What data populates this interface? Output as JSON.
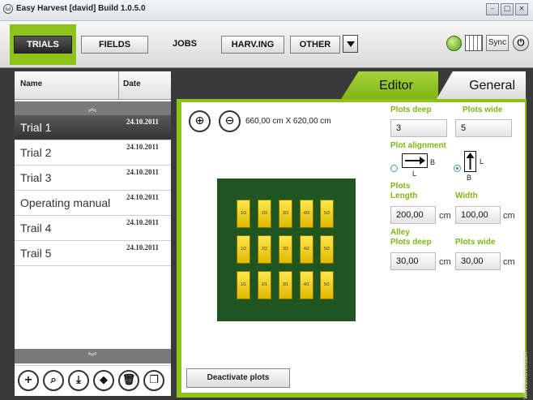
{
  "window": {
    "title": "Easy Harvest [david] Build 1.0.5.0",
    "icon": "app-icon",
    "minimize": "–",
    "maximize": "□",
    "close": "×"
  },
  "toolbar": {
    "tabs": [
      "TRIALS",
      "FIELDS",
      "JOBS",
      "HARV.ING",
      "OTHER"
    ],
    "active": "TRIALS",
    "sync_label": "Sync",
    "power_icon": "power-icon"
  },
  "trials": {
    "columns": {
      "name": "Name",
      "date": "Date"
    },
    "items": [
      {
        "name": "Trial 1",
        "date": "24.10.2011",
        "selected": true
      },
      {
        "name": "Trial 2",
        "date": "24.10.2011"
      },
      {
        "name": "Trial 3",
        "date": "24.10.2011"
      },
      {
        "name": "Operating manual",
        "date": "24.10.2011"
      },
      {
        "name": "Trail 4",
        "date": "24.10.2011"
      },
      {
        "name": "Trail 5",
        "date": "24.10.2011"
      }
    ],
    "actions": [
      "add-icon",
      "search-icon",
      "download-icon",
      "erase-icon",
      "trash-icon",
      "copy-icon"
    ]
  },
  "editor": {
    "tabs": {
      "editor": "Editor",
      "general": "General"
    },
    "dimensions": "660,00 cm X 620,00 cm",
    "plots": [
      [
        "1/3",
        "2/3",
        "3/3",
        "4/3",
        "5/3"
      ],
      [
        "1/2",
        "2/2",
        "3/2",
        "4/2",
        "5/2"
      ],
      [
        "1/1",
        "2/1",
        "3/1",
        "4/1",
        "5/1"
      ]
    ],
    "deactivate_label": "Deactivate plots",
    "plots_deep_label": "Plots deep",
    "plots_deep": "3",
    "plots_wide_label": "Plots wide",
    "plots_wide": "5",
    "alignment_label": "Plot alignment",
    "align_a": "B",
    "align_a2": "L",
    "align_b": "L",
    "align_b2": "B",
    "plots_length_label": "Plots\nLength",
    "length": "200,00",
    "length_unit": "cm",
    "width_label": "Width",
    "width": "100,00",
    "width_unit": "cm",
    "alley_deep_label": "Alley\nPlots deep",
    "alley_deep": "30,00",
    "alley_deep_unit": "cm",
    "alley_wide_label": "Plots wide",
    "alley_wide": "30,00",
    "alley_wide_unit": "cm"
  },
  "brand": "WINTERSTEIGER",
  "colors": {
    "accent": "#8cc21a",
    "field": "#1f5520",
    "plot": "#f3cf1c"
  }
}
